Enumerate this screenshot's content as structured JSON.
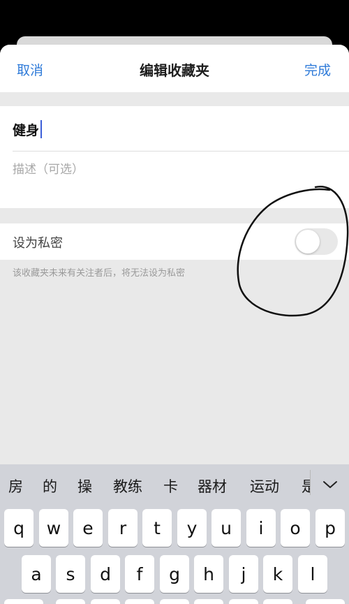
{
  "nav": {
    "cancel_label": "取消",
    "title": "编辑收藏夹",
    "done_label": "完成"
  },
  "form": {
    "name_value": "健身",
    "description_placeholder": "描述（可选）"
  },
  "private": {
    "label": "设为私密",
    "enabled": false,
    "hint": "该收藏夹未来有关注者后，将无法设为私密"
  },
  "keyboard": {
    "candidates": [
      "房",
      "的",
      "操",
      "教练",
      "卡",
      "器材",
      "运动",
      "是"
    ],
    "row1": [
      "q",
      "w",
      "e",
      "r",
      "t",
      "y",
      "u",
      "i",
      "o",
      "p"
    ],
    "row2": [
      "a",
      "s",
      "d",
      "f",
      "g",
      "h",
      "j",
      "k",
      "l"
    ]
  },
  "colors": {
    "accent": "#2f7bd9",
    "caret": "#3c5fd8",
    "annotation": "#111111"
  },
  "icons": {
    "expand": "chevron-down-icon"
  }
}
